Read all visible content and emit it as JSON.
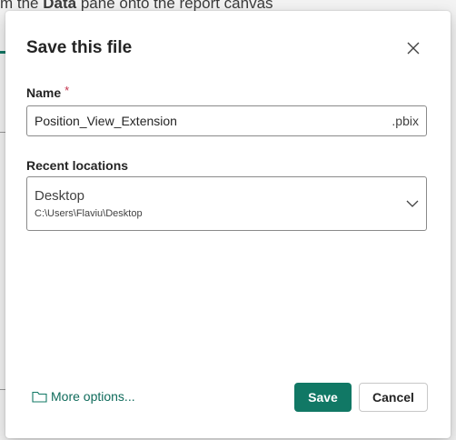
{
  "background": {
    "text_pre": "m the ",
    "text_bold": "Data",
    "text_post": " pane onto the report canvas"
  },
  "dialog": {
    "title": "Save this file",
    "name_label": "Name",
    "required_mark": "*",
    "name_value": "Position_View_Extension",
    "name_suffix": ".pbix",
    "recent_label": "Recent locations",
    "location": {
      "name": "Desktop",
      "path": "C:\\Users\\Flaviu\\Desktop"
    },
    "more_options": "More options...",
    "save_label": "Save",
    "cancel_label": "Cancel"
  },
  "colors": {
    "accent": "#117865",
    "link": "#0f6b5b",
    "required": "#c4314b"
  },
  "icons": {
    "close": "close-icon",
    "chevron": "chevron-down-icon",
    "folder": "folder-icon"
  }
}
